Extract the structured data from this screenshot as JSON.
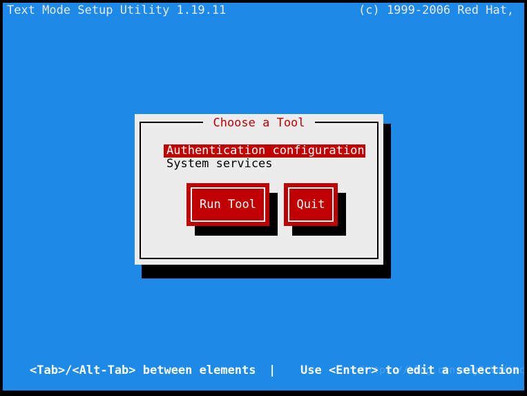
{
  "screen": {
    "background_color": "#1e8ae8",
    "frame_color": "#000000",
    "text_color": "#e8e8e8",
    "accent_color": "#c00000",
    "panel_color": "#ececec"
  },
  "topbar": {
    "left_text": "Text Mode Setup Utility 1.19.11",
    "right_text": "(c) 1999-2006 Red Hat,"
  },
  "dialog": {
    "title": "Choose a Tool",
    "items": [
      {
        "label": "Authentication configuration",
        "selected": true
      },
      {
        "label": "System services",
        "selected": false
      }
    ],
    "buttons": [
      {
        "label": "Run Tool",
        "name": "run-tool-button"
      },
      {
        "label": "Quit",
        "name": "quit-button"
      }
    ]
  },
  "statusbar": {
    "left_hint": "<Tab>/<Alt-Tab> between elements",
    "separator": "|",
    "right_hint": "Use <Enter> to edit a selection",
    "watermark": "https://blog.ctn.aeg8tVa/iectional"
  }
}
